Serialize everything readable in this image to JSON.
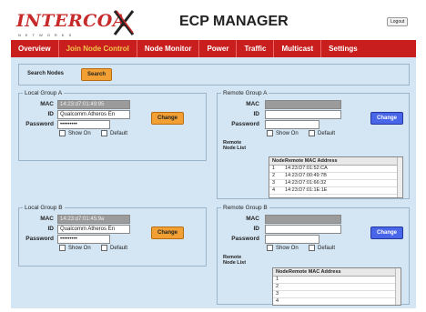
{
  "brand": {
    "logo_text": "INTERCOA",
    "logo_sub": "NETWORKS"
  },
  "app_title": "ECP MANAGER",
  "logout_label": "Logout",
  "nav": [
    {
      "label": "Overview"
    },
    {
      "label": "Join Node Control",
      "active": true
    },
    {
      "label": "Node Monitor"
    },
    {
      "label": "Power"
    },
    {
      "label": "Traffic"
    },
    {
      "label": "Multicast"
    },
    {
      "label": "Settings"
    }
  ],
  "search": {
    "label": "Search Nodes",
    "button": "Search"
  },
  "labels": {
    "mac": "MAC",
    "id": "ID",
    "password": "Password",
    "show_on": "Show On",
    "default": "Default",
    "change": "Change",
    "remote_node_list": "Remote Node List",
    "col_node": "Node",
    "col_mac": "Remote MAC Address"
  },
  "local_a": {
    "title": "Local Group A",
    "mac": "14:23:d7:01:49:95",
    "id": "Qualcomm Atheros En",
    "password": "•••••••••"
  },
  "local_b": {
    "title": "Local Group B",
    "mac": "14:23:d7:01:45:9a",
    "id": "Qualcomm Atheros En",
    "password": "•••••••••"
  },
  "remote_a": {
    "title": "Remote Group A",
    "mac": "",
    "id": "",
    "password": "",
    "rows": [
      {
        "node": "1",
        "mac": "14:23:D7:01:52:CA"
      },
      {
        "node": "2",
        "mac": "14:23:D7:00:49:7B"
      },
      {
        "node": "3",
        "mac": "14:23:D7:01:66:32"
      },
      {
        "node": "4",
        "mac": "14:23:D7:01:1E:1E"
      }
    ]
  },
  "remote_b": {
    "title": "Remote Group B",
    "mac": "",
    "id": "",
    "password": "",
    "rows": [
      {
        "node": "1",
        "mac": ""
      },
      {
        "node": "2",
        "mac": ""
      },
      {
        "node": "3",
        "mac": ""
      },
      {
        "node": "4",
        "mac": ""
      }
    ]
  },
  "colors": {
    "nav_bg": "#c81e1e",
    "nav_active": "#f3c84b",
    "content_bg": "#d4e6f4",
    "change_local": "#f2a033",
    "change_remote": "#4a66e8"
  }
}
